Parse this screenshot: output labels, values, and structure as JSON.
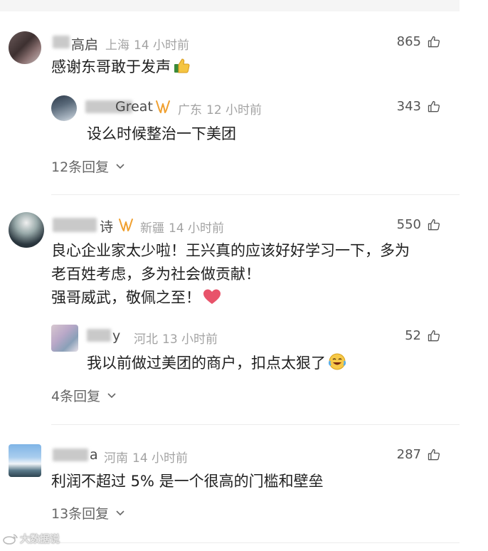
{
  "comments": [
    {
      "user": "高启",
      "location": "上海",
      "time": "14 小时前",
      "likes": "865",
      "text": "感谢东哥敢于发声",
      "emoji": "thumbs-up-emoji",
      "reply": {
        "user": "Great",
        "location": "广东",
        "time": "12 小时前",
        "likes": "343",
        "text": "设么时候整治一下美团"
      },
      "replies_count": "12条回复"
    },
    {
      "user": "诗",
      "location": "新疆",
      "time": "14 小时前",
      "likes": "550",
      "lines": [
        "良心企业家太少啦！王兴真的应该好好学习一下，多为",
        "老百姓考虑，多为社会做贡献！",
        "强哥威武，敬佩之至！"
      ],
      "emoji": "heart-emoji",
      "reply": {
        "user": "y",
        "location": "河北",
        "time": "13 小时前",
        "likes": "52",
        "text": "我以前做过美团的商户，扣点太狠了",
        "emoji": "laughing-tears-emoji"
      },
      "replies_count": "4条回复"
    },
    {
      "user": "a",
      "location": "河南",
      "time": "14 小时前",
      "likes": "287",
      "text": "利润不超过 5% 是一个很高的门槛和壁垒",
      "replies_count": "13条回复"
    }
  ],
  "watermark": "大数据说",
  "colors": {
    "vip_badge": "#f0a030",
    "heart": "#e8536a",
    "meta": "#a3a3a3"
  }
}
